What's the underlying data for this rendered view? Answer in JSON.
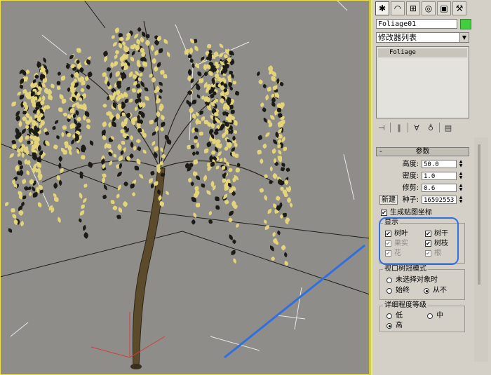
{
  "viewport": {
    "frame_color": "#f0e040",
    "background": "#8e8d8a",
    "tree": {
      "leaf_color": "#e4d479",
      "leaf_dark": "#1c1b16",
      "trunk_color": "#5c4a2c"
    }
  },
  "panel_tabs": [
    {
      "icon": "create-icon",
      "glyph": "✱",
      "active": true
    },
    {
      "icon": "modify-icon",
      "glyph": "◠",
      "active": false
    },
    {
      "icon": "hierarchy-icon",
      "glyph": "⊞",
      "active": false
    },
    {
      "icon": "motion-icon",
      "glyph": "◎",
      "active": false
    },
    {
      "icon": "display-icon",
      "glyph": "▣",
      "active": false
    },
    {
      "icon": "utilities-icon",
      "glyph": "⚒",
      "active": false
    }
  ],
  "object": {
    "name": "Foliage01",
    "color": "#3fcf3f"
  },
  "modifier_list": {
    "label": "修改器列表"
  },
  "stack": {
    "items": [
      "Foliage"
    ]
  },
  "stack_tools": [
    {
      "icon": "pin-stack-icon",
      "glyph": "⊣"
    },
    {
      "icon": "show-end-result-icon",
      "glyph": "∥"
    },
    {
      "icon": "make-unique-icon",
      "glyph": "∀"
    },
    {
      "icon": "remove-modifier-icon",
      "glyph": "♁"
    },
    {
      "icon": "configure-sets-icon",
      "glyph": "▤"
    }
  ],
  "rollout": {
    "title": "参数",
    "toggle": "-"
  },
  "params": [
    {
      "label": "高度:",
      "value": "50.0"
    },
    {
      "label": "密度:",
      "value": "1.0"
    },
    {
      "label": "修剪:",
      "value": "0.6"
    },
    {
      "label": "种子:",
      "value": "16592553"
    }
  ],
  "new_button": "新建",
  "gen_mapping": {
    "label": "生成贴图坐标",
    "checked": true
  },
  "display_group": {
    "title": "显示",
    "items": [
      {
        "label": "树叶",
        "checked": true,
        "disabled": false
      },
      {
        "label": "树干",
        "checked": true,
        "disabled": false
      },
      {
        "label": "果实",
        "checked": true,
        "disabled": true
      },
      {
        "label": "树枝",
        "checked": true,
        "disabled": false
      },
      {
        "label": "花",
        "checked": true,
        "disabled": true
      },
      {
        "label": "根",
        "checked": true,
        "disabled": true
      }
    ]
  },
  "canopy_group": {
    "title": "视口树冠模式",
    "options": [
      {
        "label": "未选择对象时",
        "selected": false
      },
      {
        "label": "始终",
        "selected": false
      },
      {
        "label": "从不",
        "selected": true
      }
    ]
  },
  "lod_group": {
    "title": "详细程度等级",
    "options": [
      {
        "label": "低",
        "selected": false
      },
      {
        "label": "中",
        "selected": false
      },
      {
        "label": "高",
        "selected": true
      }
    ]
  },
  "annotation": {
    "color": "#2f6fe0"
  }
}
